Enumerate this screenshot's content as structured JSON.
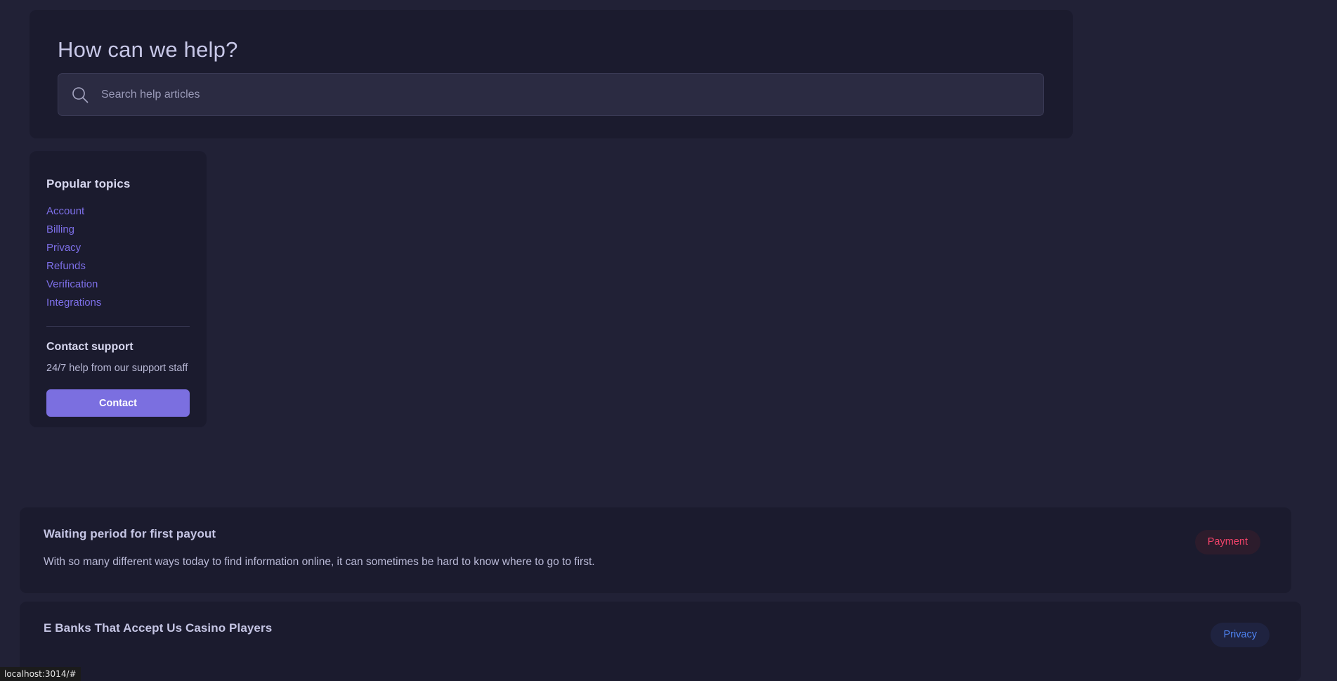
{
  "hero": {
    "title": "How can we help?",
    "search": {
      "icon": "search-icon",
      "placeholder": "Search help articles",
      "value": ""
    }
  },
  "sidebar": {
    "popular_topics_heading": "Popular topics",
    "topics": [
      {
        "label": "Account"
      },
      {
        "label": "Billing"
      },
      {
        "label": "Privacy"
      },
      {
        "label": "Refunds"
      },
      {
        "label": "Verification"
      },
      {
        "label": "Integrations"
      }
    ],
    "contact": {
      "heading": "Contact support",
      "subtitle": "24/7 help from our support staff",
      "button_label": "Contact"
    }
  },
  "articles": [
    {
      "title": "Waiting period for first payout",
      "description": "With so many different ways today to find information online, it can sometimes be hard to know where to go to first.",
      "badge": "Payment"
    },
    {
      "title": "E Banks That Accept Us Casino Players",
      "description": "",
      "badge": "Privacy"
    }
  ],
  "statusbar": {
    "url": "localhost:3014/#"
  },
  "colors": {
    "page_bg": "#212136",
    "panel_bg": "#1b1b2e",
    "input_bg": "#2b2b42",
    "accent_purple": "#7b6fe0",
    "link_purple": "#7d6fe8",
    "badge_payment": "#f2436a",
    "badge_privacy": "#4f83f2"
  }
}
